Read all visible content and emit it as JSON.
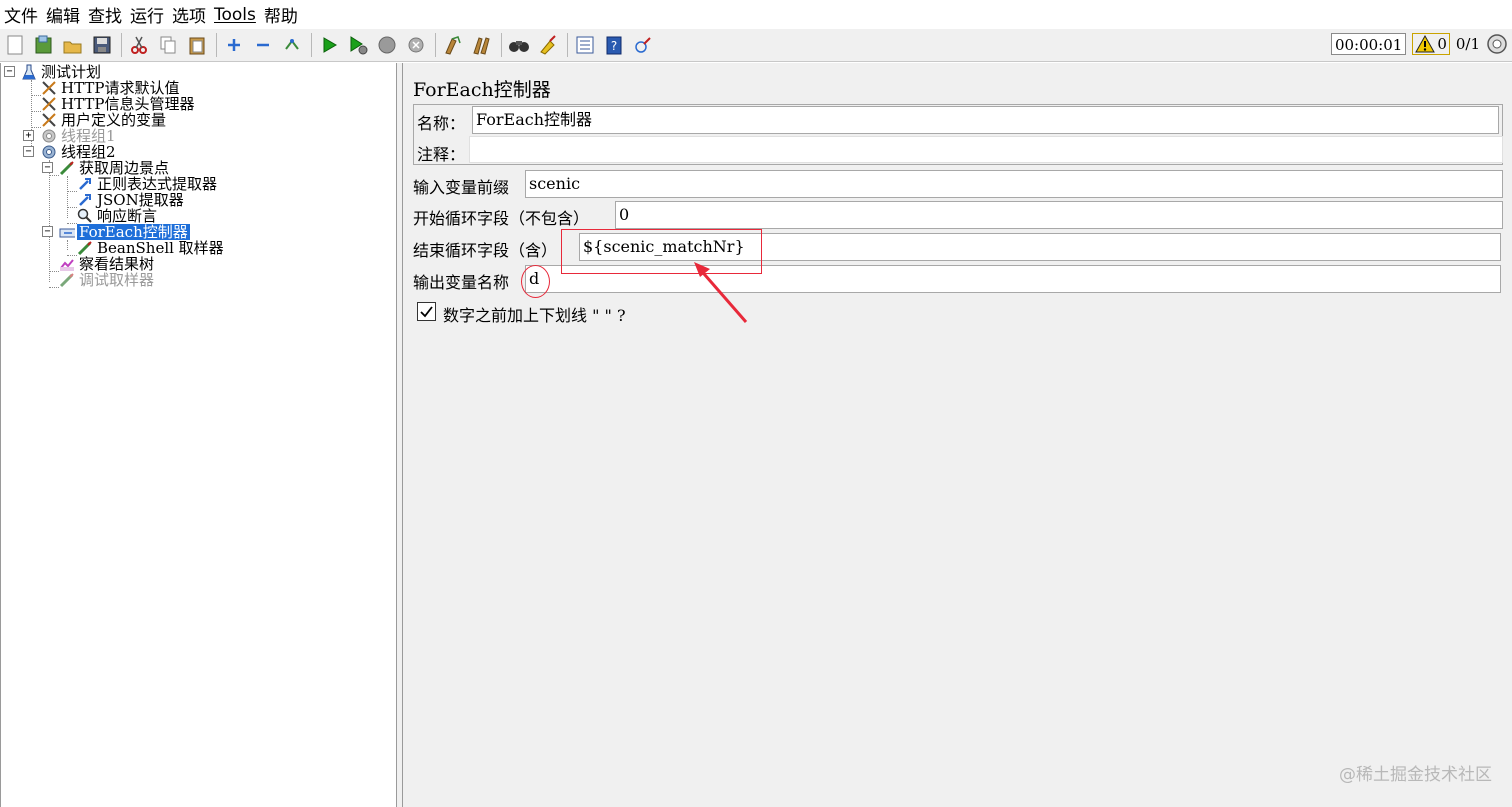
{
  "menu": {
    "items": [
      "文件",
      "编辑",
      "查找",
      "运行",
      "选项",
      "Tools",
      "帮助"
    ]
  },
  "toolbar": {
    "buttons": [
      "new-icon",
      "templates-icon",
      "open-icon",
      "save-icon",
      "cut-icon",
      "copy-icon",
      "paste-icon",
      "expand-icon",
      "collapse-icon",
      "toggle-icon",
      "start-icon",
      "start-no-pause-icon",
      "stop-icon",
      "shutdown-icon",
      "clear-icon",
      "clear-all-icon",
      "search-icon",
      "reset-search-icon",
      "function-helper-icon",
      "help-icon",
      "remote-icon"
    ],
    "timer": "00:00:01",
    "warning_count": "0",
    "threads": "0/1"
  },
  "tree": {
    "nodes": [
      {
        "label": "测试计划",
        "icon": "test-plan-icon",
        "disabled": false,
        "selected": false
      },
      {
        "label": "HTTP请求默认值",
        "icon": "config-element-icon",
        "disabled": false,
        "selected": false
      },
      {
        "label": "HTTP信息头管理器",
        "icon": "config-element-icon",
        "disabled": false,
        "selected": false
      },
      {
        "label": "用户定义的变量",
        "icon": "config-element-icon",
        "disabled": false,
        "selected": false
      },
      {
        "label": "线程组1",
        "icon": "thread-group-icon",
        "disabled": true,
        "selected": false
      },
      {
        "label": "线程组2",
        "icon": "thread-group-icon",
        "disabled": false,
        "selected": false
      },
      {
        "label": "获取周边景点",
        "icon": "sampler-icon",
        "disabled": false,
        "selected": false
      },
      {
        "label": "正则表达式提取器",
        "icon": "post-processor-icon",
        "disabled": false,
        "selected": false
      },
      {
        "label": "JSON提取器",
        "icon": "post-processor-icon",
        "disabled": false,
        "selected": false
      },
      {
        "label": "响应断言",
        "icon": "assertion-icon",
        "disabled": false,
        "selected": false
      },
      {
        "label": "ForEach控制器",
        "icon": "controller-icon",
        "disabled": false,
        "selected": true
      },
      {
        "label": "BeanShell 取样器",
        "icon": "sampler-icon",
        "disabled": false,
        "selected": false
      },
      {
        "label": "察看结果树",
        "icon": "listener-icon",
        "disabled": false,
        "selected": false
      },
      {
        "label": "调试取样器",
        "icon": "sampler-icon",
        "disabled": true,
        "selected": false
      }
    ]
  },
  "editor": {
    "title": "ForEach控制器",
    "name_label": "名称：",
    "name_value": "ForEach控制器",
    "comment_label": "注释：",
    "comment_value": "",
    "input_prefix_label": "输入变量前缀",
    "input_prefix_value": "scenic",
    "start_index_label": "开始循环字段（不包含）",
    "start_index_value": "0",
    "end_index_label": "结束循环字段（含）",
    "end_index_value": "${scenic_matchNr}",
    "output_var_label": "输出变量名称",
    "output_var_value": "d",
    "use_separator_label": "数字之前加上下划线 \" \" ?",
    "use_separator_checked": true
  },
  "annotation_color": "#e8293a",
  "selection_color": "#1e6fd9",
  "watermark": "@稀土掘金技术社区"
}
